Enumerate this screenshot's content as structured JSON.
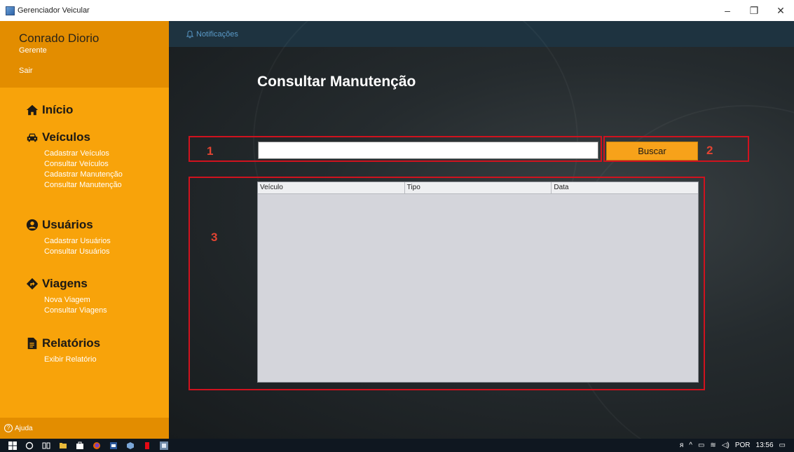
{
  "window": {
    "title": "Gerenciador Veicular",
    "controls": {
      "minimize": "–",
      "restore": "❐",
      "close": "✕"
    }
  },
  "user": {
    "name": "Conrado Diorio",
    "role": "Gerente",
    "logout": "Sair"
  },
  "sidebar": {
    "inicio": {
      "title": "Início",
      "icon": "home-icon"
    },
    "veiculos": {
      "title": "Veículos",
      "icon": "car-icon",
      "items": [
        "Cadastrar Veículos",
        "Consultar Veículos",
        "Cadastrar Manutenção",
        "Consultar Manutenção"
      ]
    },
    "usuarios": {
      "title": "Usuários",
      "icon": "user-circle-icon",
      "items": [
        "Cadastrar Usuários",
        "Consultar Usuários"
      ]
    },
    "viagens": {
      "title": "Viagens",
      "icon": "directions-icon",
      "items": [
        "Nova Viagem",
        "Consultar Viagens"
      ]
    },
    "relatorios": {
      "title": "Relatórios",
      "icon": "file-icon",
      "items": [
        "Exibir Relatório"
      ]
    },
    "help": "Ajuda"
  },
  "topbar": {
    "notifications": "Notificações"
  },
  "page": {
    "title": "Consultar Manutenção",
    "search": {
      "value": "",
      "placeholder": ""
    },
    "search_button": "Buscar",
    "markers": [
      "1",
      "2",
      "3"
    ],
    "table": {
      "columns": [
        "Veículo",
        "Tipo",
        "Data"
      ],
      "rows": []
    }
  },
  "taskbar": {
    "tray": {
      "language": "POR",
      "time": "13:56"
    }
  },
  "colors": {
    "sidebar": "#f8a30a",
    "sidebar_dark": "#e38d00",
    "topbar": "#1e3340",
    "annotation_red": "#d0121e",
    "button": "#f7a21a"
  }
}
